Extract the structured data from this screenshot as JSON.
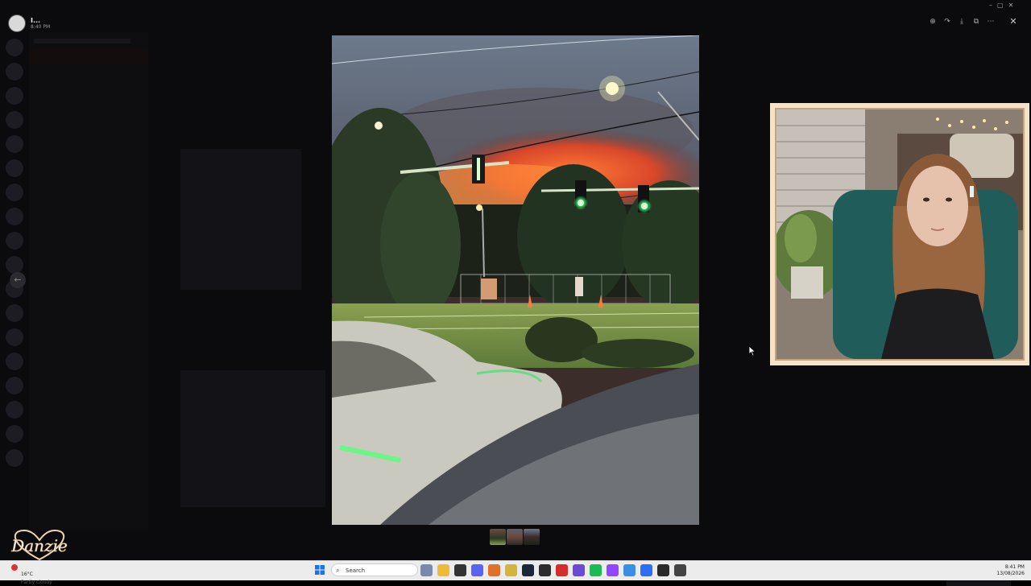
{
  "viewer": {
    "user_name": "I...",
    "timestamp": "8:40 PM",
    "tools": [
      "zoom-icon",
      "forward-icon",
      "download-icon",
      "open-external-icon",
      "more-icon"
    ],
    "close_icon": "close-icon"
  },
  "taskbar": {
    "weather_temp": "16°C",
    "weather_condition": "Partly cloudy",
    "search_placeholder": "Search",
    "clock_time": "8:41 PM",
    "clock_date": "13/08/2026",
    "apps": [
      {
        "name": "widgets-app",
        "color": "#7a8aa8"
      },
      {
        "name": "file-manager-app",
        "color": "#f0b93a"
      },
      {
        "name": "terminal-app",
        "color": "#333333"
      },
      {
        "name": "discord-app",
        "color": "#5865f2"
      },
      {
        "name": "firefox-app",
        "color": "#e0702a"
      },
      {
        "name": "game-app",
        "color": "#d2b53a"
      },
      {
        "name": "steam-app",
        "color": "#1b2838"
      },
      {
        "name": "media-app",
        "color": "#2c2c2c"
      },
      {
        "name": "record-app",
        "color": "#d62c2c"
      },
      {
        "name": "grid-app",
        "color": "#6a4ad6"
      },
      {
        "name": "spotify-app",
        "color": "#1db954"
      },
      {
        "name": "twitch-app",
        "color": "#9146ff"
      },
      {
        "name": "window-app",
        "color": "#3a8ee6"
      },
      {
        "name": "zoom-app",
        "color": "#2d6ff2"
      },
      {
        "name": "notes-app",
        "color": "#2a2a2a"
      },
      {
        "name": "extra-app",
        "color": "#444444"
      }
    ]
  },
  "watermark": {
    "text": "Danzie"
  },
  "colors": {
    "accent": "#5865f2",
    "webcam_frame": "#f3e3c8",
    "fire": "#e0552a"
  }
}
